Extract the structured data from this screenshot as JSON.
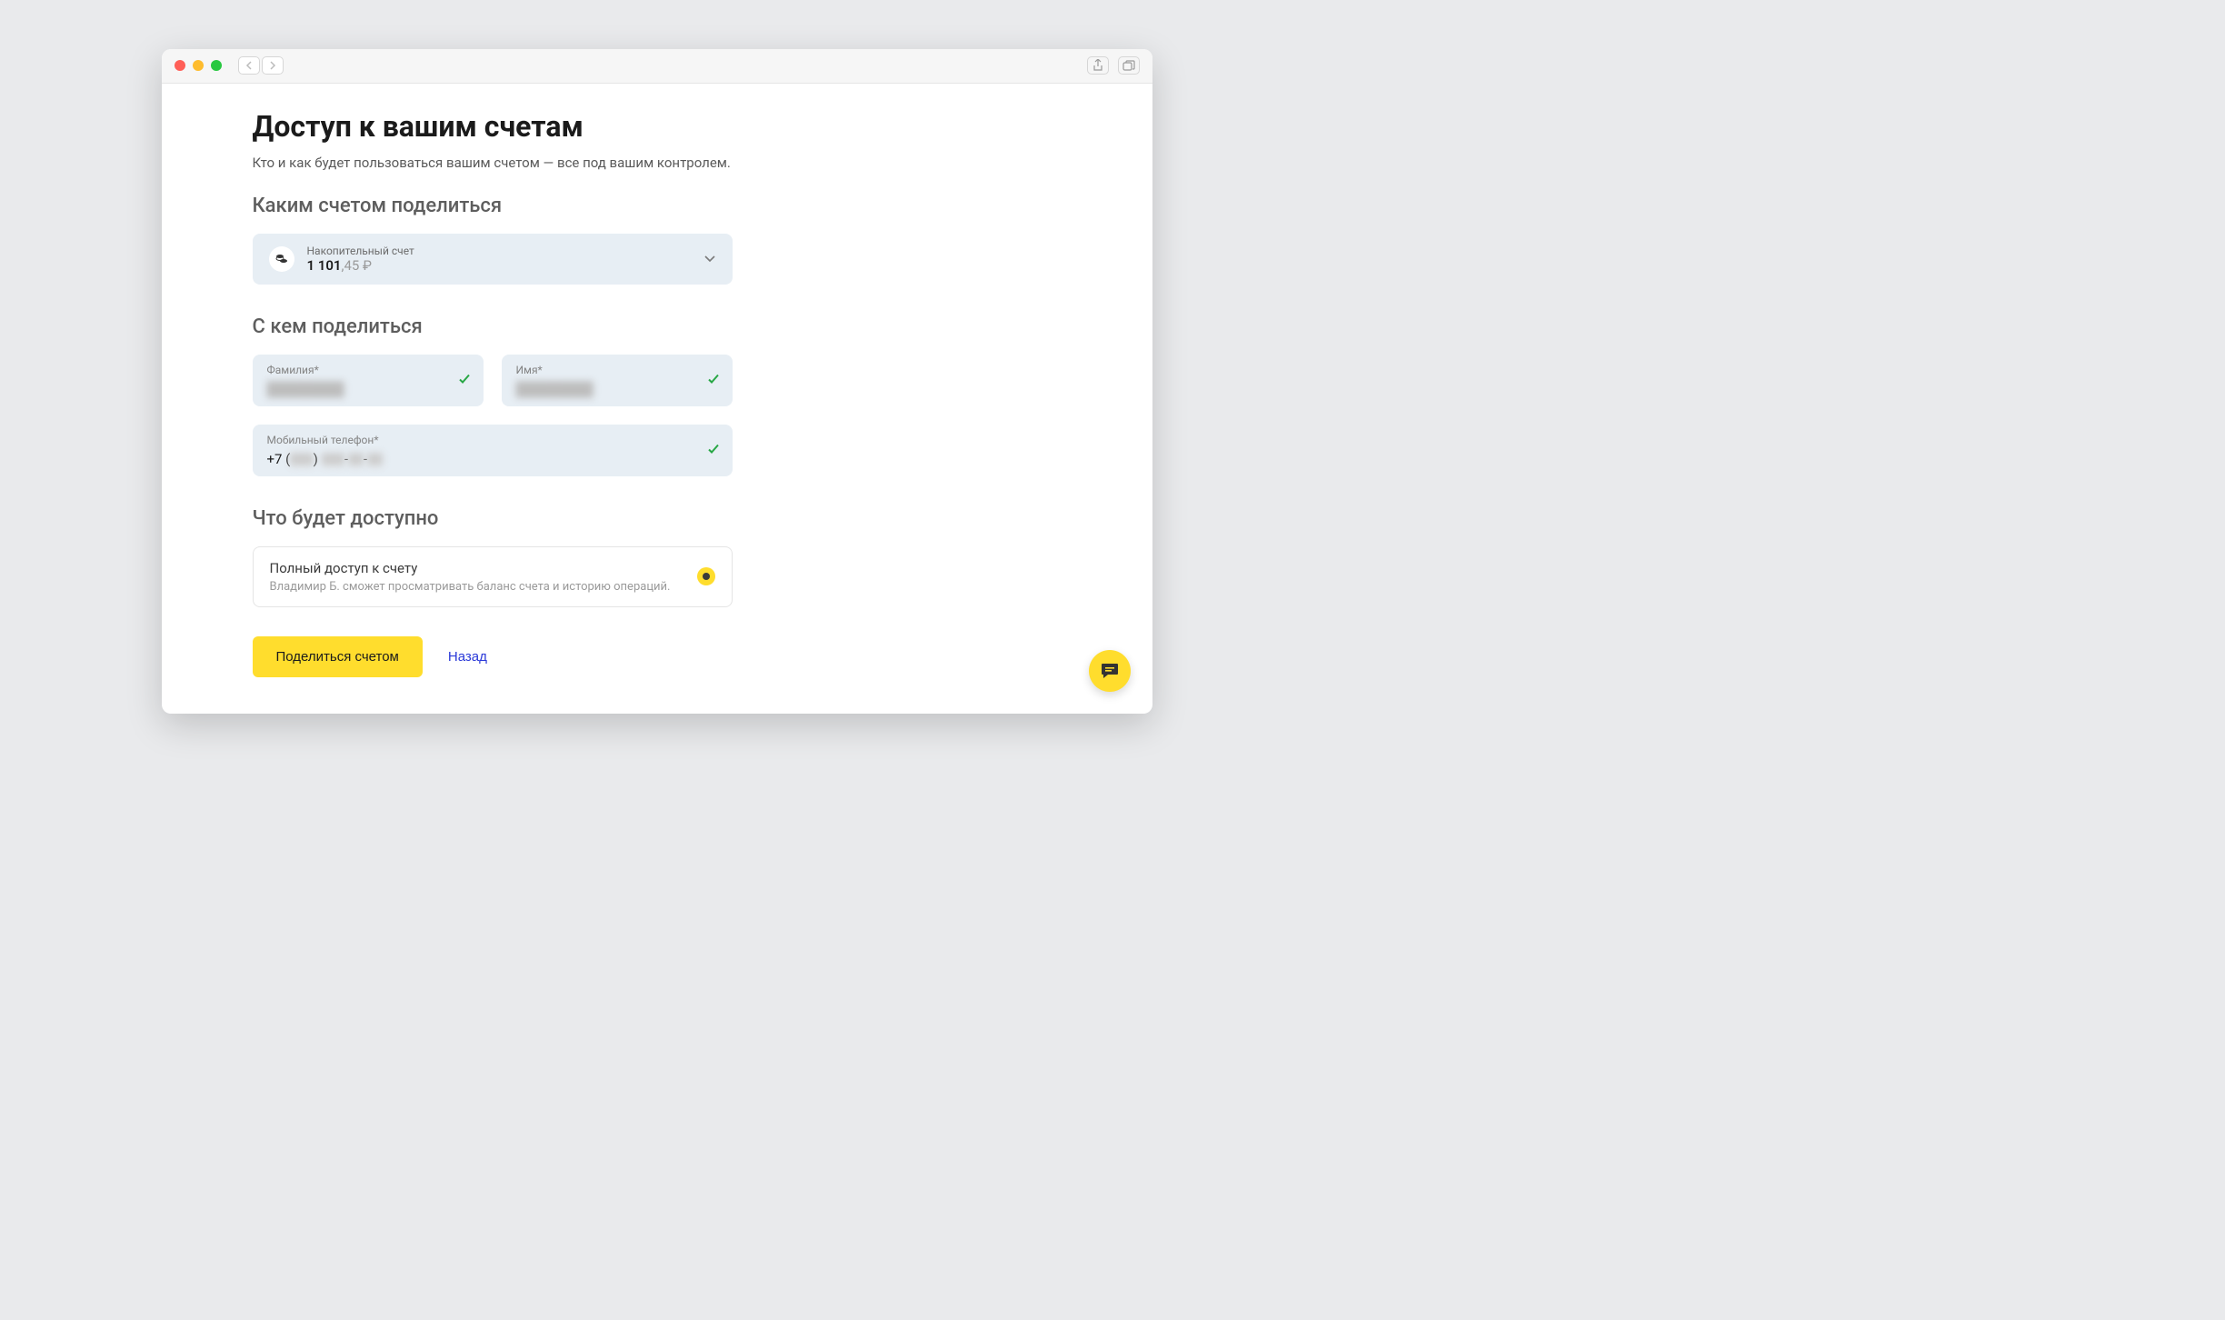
{
  "page": {
    "title": "Доступ к вашим счетам",
    "subtitle": "Кто и как будет пользоваться вашим счетом — все под вашим контролем."
  },
  "sections": {
    "account": "Каким счетом поделиться",
    "share_with": "С кем поделиться",
    "access": "Что будет доступно"
  },
  "account_select": {
    "label": "Накопительный счет",
    "balance_int": "1 101",
    "balance_dec": ",45 ₽"
  },
  "form": {
    "surname_label": "Фамилия*",
    "surname_value": "████████",
    "name_label": "Имя*",
    "name_value": "████████",
    "phone_label": "Мобильный телефон*",
    "phone_value": "+7 (███) ███-██-██"
  },
  "access_option": {
    "title": "Полный доступ к счету",
    "desc": "Владимир Б. сможет просматривать баланс счета и историю операций."
  },
  "buttons": {
    "share": "Поделиться счетом",
    "back": "Назад"
  }
}
